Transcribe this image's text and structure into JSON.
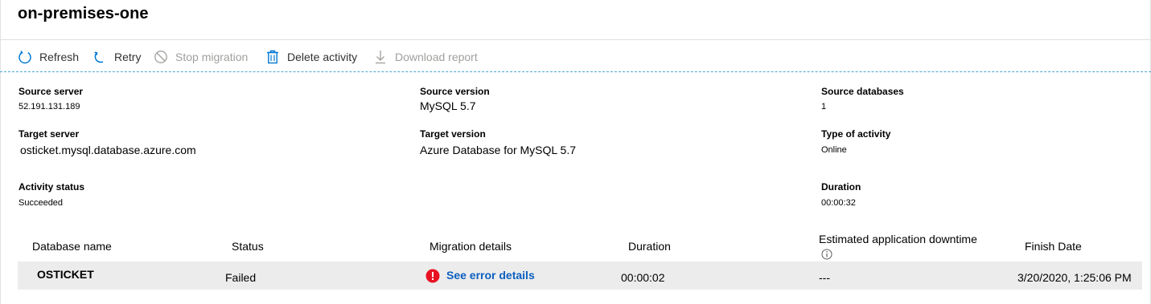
{
  "page": {
    "title": "on-premises-one"
  },
  "toolbar": {
    "refresh": "Refresh",
    "retry": "Retry",
    "stop_migration": "Stop migration",
    "delete_activity": "Delete activity",
    "download_report": "Download report"
  },
  "summary": {
    "source_server": {
      "label": "Source server",
      "value": "52.191.131.189"
    },
    "source_version": {
      "label": "Source version",
      "value": "MySQL 5.7"
    },
    "source_databases": {
      "label": "Source databases",
      "value": "1"
    },
    "target_server": {
      "label": "Target server",
      "value": "osticket.mysql.database.azure.com"
    },
    "target_version": {
      "label": "Target version",
      "value": "Azure Database for MySQL 5.7"
    },
    "activity_type": {
      "label": "Type of activity",
      "value": "Online"
    },
    "activity_status": {
      "label": "Activity status",
      "value": "Succeeded"
    },
    "duration": {
      "label": "Duration",
      "value": "00:00:32"
    }
  },
  "table": {
    "headers": {
      "database_name": "Database name",
      "status": "Status",
      "migration_details": "Migration details",
      "duration": "Duration",
      "downtime": "Estimated application downtime",
      "finish_date": "Finish Date"
    },
    "rows": [
      {
        "database_name": "OSTICKET",
        "status": "Failed",
        "migration_details": "See error details",
        "duration": "00:00:02",
        "downtime": "---",
        "finish_date": "3/20/2020, 1:25:06 PM"
      }
    ]
  },
  "colors": {
    "link": "#0b5fc0",
    "error": "#e81123",
    "accent": "#0078d4",
    "disabled": "#a19f9d"
  }
}
